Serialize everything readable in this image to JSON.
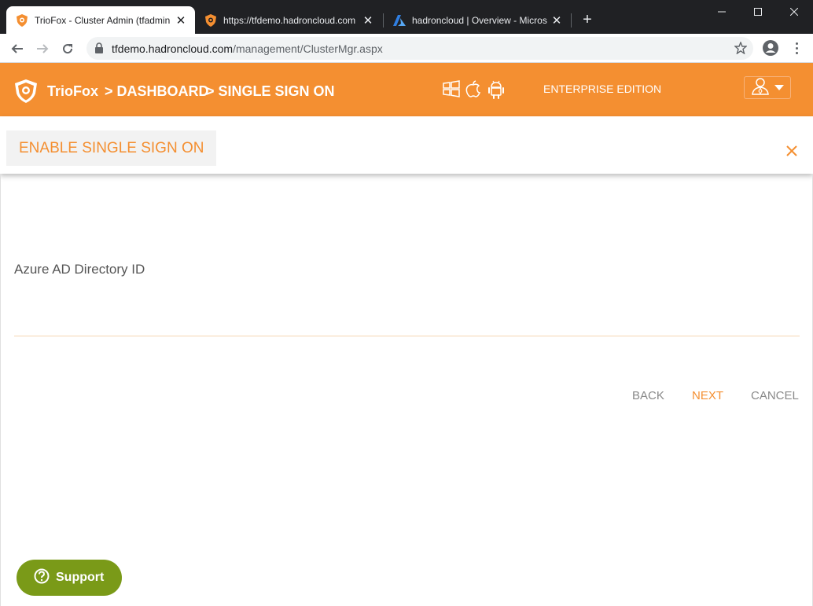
{
  "browser": {
    "tabs": [
      {
        "title": "TrioFox - Cluster Admin (tfadmin",
        "active": true,
        "favicon": "triofox-shield-icon"
      },
      {
        "title": "https://tfdemo.hadroncloud.com",
        "active": false,
        "favicon": "triofox-shield-icon"
      },
      {
        "title": "hadroncloud | Overview - Micros",
        "active": false,
        "favicon": "azure-icon"
      }
    ],
    "url_host": "tfdemo.hadroncloud.com",
    "url_path": "/management/ClusterMgr.aspx"
  },
  "app": {
    "brand": "TrioFox",
    "breadcrumb": [
      "> DASHBOARD",
      "> SINGLE SIGN ON"
    ],
    "edition": "ENTERPRISE EDITION",
    "accent_color": "#f48f31"
  },
  "dialog": {
    "title": "ENABLE SINGLE SIGN ON",
    "field_label": "Azure AD Directory ID",
    "field_value": "",
    "actions": {
      "back": "BACK",
      "next": "NEXT",
      "cancel": "CANCEL"
    }
  },
  "support": {
    "label": "Support"
  }
}
